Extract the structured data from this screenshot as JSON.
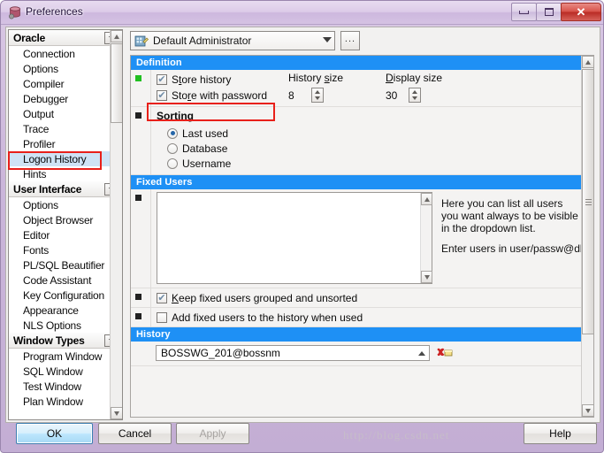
{
  "window": {
    "title": "Preferences",
    "icon": "database-icon",
    "buttons": {
      "minimize": "minimize-icon",
      "maximize": "maximize-icon",
      "close": "✕"
    }
  },
  "sidebar": {
    "groups": [
      {
        "label": "Oracle",
        "items": [
          "Connection",
          "Options",
          "Compiler",
          "Debugger",
          "Output",
          "Trace",
          "Profiler",
          "Logon History",
          "Hints"
        ],
        "selected": "Logon History"
      },
      {
        "label": "User Interface",
        "items": [
          "Options",
          "Object Browser",
          "Editor",
          "Fonts",
          "PL/SQL Beautifier",
          "Code Assistant",
          "Key Configuration",
          "Appearance",
          "NLS Options"
        ],
        "selected": ""
      },
      {
        "label": "Window Types",
        "items": [
          "Program Window",
          "SQL Window",
          "Test Window",
          "Plan Window"
        ],
        "selected": ""
      }
    ]
  },
  "profile": {
    "value": "Default Administrator",
    "icon": "user-profile-icon",
    "more_button": "...",
    "dropdown_icon": "chevron-down-icon"
  },
  "sections": {
    "definition": {
      "header": "Definition",
      "store_history": {
        "label_pre": "S",
        "label_mn": "t",
        "label_post": "ore history",
        "label": "Store history",
        "checked": true
      },
      "store_with_password": {
        "label_pre": "Sto",
        "label_mn": "r",
        "label_post": "e with password",
        "label": "Store with password",
        "checked": true
      },
      "history_size": {
        "label_pre": "History ",
        "label_mn": "s",
        "label_post": "ize",
        "label": "History size",
        "value": "8"
      },
      "display_size": {
        "label_pre": "",
        "label_mn": "D",
        "label_post": "isplay size",
        "label": "Display size",
        "value": "30"
      },
      "sorting": {
        "title": "Sorting",
        "options": [
          "Last used",
          "Database",
          "Username"
        ],
        "selected": "Last used"
      }
    },
    "fixed_users": {
      "header": "Fixed Users",
      "textarea_value": "",
      "help_line_1": "Here you can list all users",
      "help_line_2": "you want always to be visible",
      "help_line_3": "in the dropdown list.",
      "help_line_4": "Enter users in user/passw@db s",
      "keep_grouped": {
        "label_pre": "",
        "label_mn": "K",
        "label_post": "eep fixed users grouped and unsorted",
        "label": "Keep fixed users grouped and unsorted",
        "checked": true
      },
      "add_to_history": {
        "label_pre": "",
        "label_mn": "",
        "label_post": "Add fixed users to the history when used",
        "label": "Add fixed users to the history when used",
        "checked": false
      }
    },
    "history": {
      "header": "History",
      "entry": "BOSSWG_201@bossnm",
      "delete_icon": "delete-entry-icon",
      "dropdown_icon": "chevron-up-icon"
    }
  },
  "footer": {
    "ok": "OK",
    "cancel": "Cancel",
    "apply": "Apply",
    "help": "Help"
  },
  "watermark": "http://blog.csdn.net",
  "colors": {
    "section_header_bg": "#1e90f5",
    "selection_bg": "#cfe3f5",
    "highlight_box": "#e8201a",
    "title_bar": "#d5c2e3",
    "close_button": "#c43a32",
    "bullet_green": "#21bf21",
    "primary_button": "#bde6fd"
  }
}
